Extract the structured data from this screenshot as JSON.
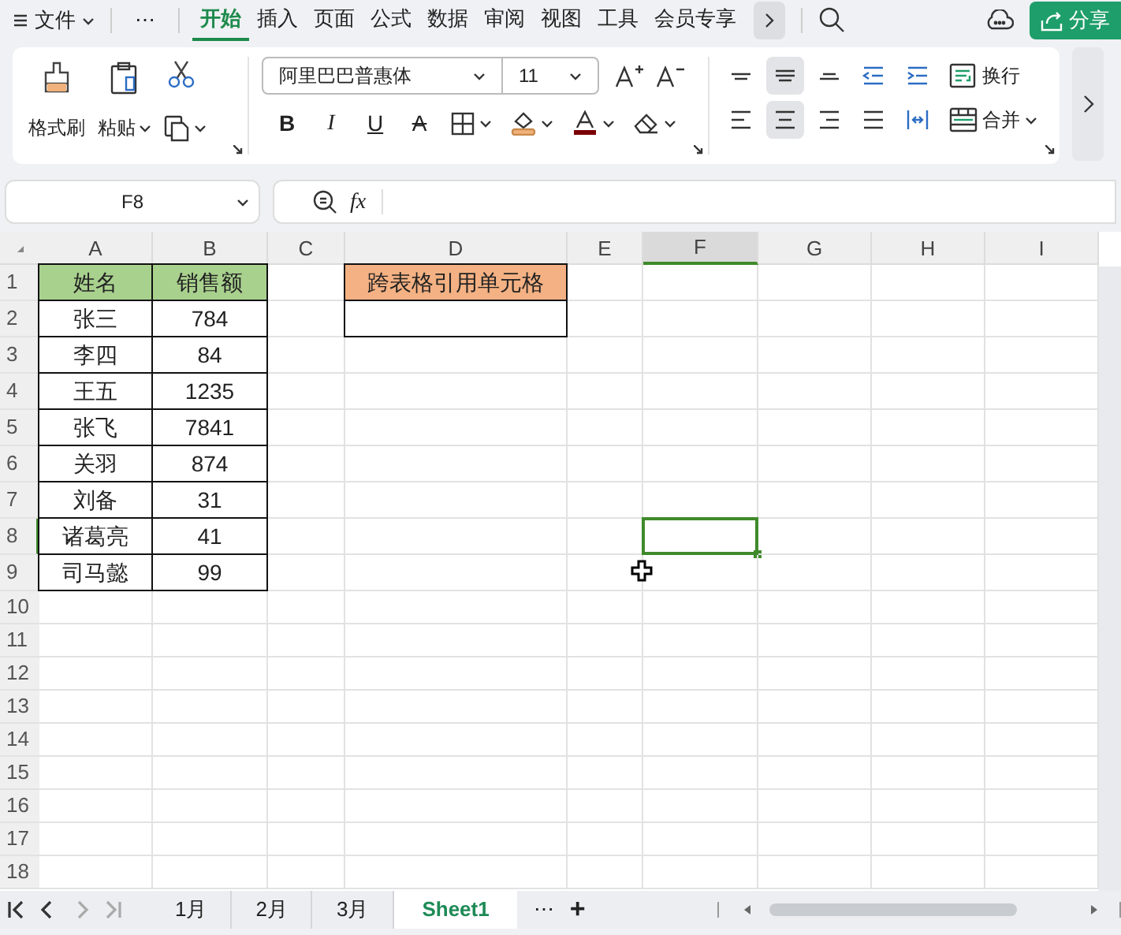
{
  "menu_bar": {
    "file_menu": "文件",
    "more": "⋯",
    "tabs": [
      {
        "label": "开始",
        "selected": true
      },
      {
        "label": "插入",
        "selected": false
      },
      {
        "label": "页面",
        "selected": false
      },
      {
        "label": "公式",
        "selected": false
      },
      {
        "label": "数据",
        "selected": false
      },
      {
        "label": "审阅",
        "selected": false
      },
      {
        "label": "视图",
        "selected": false
      },
      {
        "label": "工具",
        "selected": false
      },
      {
        "label": "会员专享",
        "selected": false
      }
    ],
    "share": "分享"
  },
  "ribbon": {
    "format_painter": "格式刷",
    "paste": "粘贴",
    "font_name": "阿里巴巴普惠体",
    "font_size": "11",
    "style_buttons": [
      {
        "kind": "bold",
        "label": "B"
      },
      {
        "kind": "italic",
        "label": "I"
      },
      {
        "kind": "underline",
        "label": "U"
      },
      {
        "kind": "strike",
        "label": "A"
      }
    ],
    "align_rows": [
      [
        {
          "kind": "top",
          "selected": false
        },
        {
          "kind": "middle",
          "selected": true
        },
        {
          "kind": "bottom",
          "selected": false
        },
        {
          "kind": "outdent",
          "selected": false
        },
        {
          "kind": "indent",
          "selected": false
        }
      ],
      [
        {
          "kind": "left",
          "selected": false
        },
        {
          "kind": "center",
          "selected": true
        },
        {
          "kind": "right",
          "selected": false
        },
        {
          "kind": "justify",
          "selected": false
        },
        {
          "kind": "distributed",
          "selected": false
        }
      ]
    ],
    "wrap": "换行",
    "merge": "合并"
  },
  "formula_bar": {
    "name_box": "F8",
    "fx": "fx"
  },
  "grid": {
    "columns": [
      {
        "label": "A",
        "selected": false
      },
      {
        "label": "B",
        "selected": false
      },
      {
        "label": "C",
        "selected": false
      },
      {
        "label": "D",
        "selected": false
      },
      {
        "label": "E",
        "selected": false
      },
      {
        "label": "F",
        "selected": true
      },
      {
        "label": "G",
        "selected": false
      },
      {
        "label": "H",
        "selected": false
      },
      {
        "label": "I",
        "selected": false
      }
    ],
    "rows": [
      {
        "label": "1",
        "selected": false,
        "cells": [
          {
            "text": "姓名",
            "color": "#a9d18e",
            "bordered": true,
            "selected": false
          },
          {
            "text": "销售额",
            "color": "#a9d18e",
            "bordered": true,
            "selected": false
          },
          {
            "text": "",
            "bordered": false,
            "selected": false
          },
          {
            "text": "跨表格引用单元格",
            "color": "#f4b183",
            "bordered": true,
            "selected": false
          }
        ]
      },
      {
        "label": "2",
        "selected": false,
        "cells": [
          {
            "text": "张三",
            "bordered": true,
            "selected": false
          },
          {
            "text": "784",
            "bordered": true,
            "selected": false
          },
          {
            "text": "",
            "bordered": false,
            "selected": false
          },
          {
            "text": "",
            "bordered": true,
            "selected": false
          }
        ]
      },
      {
        "label": "3",
        "selected": false,
        "cells": [
          {
            "text": "李四",
            "bordered": true,
            "selected": false
          },
          {
            "text": "84",
            "bordered": true,
            "selected": false
          }
        ]
      },
      {
        "label": "4",
        "selected": false,
        "cells": [
          {
            "text": "王五",
            "bordered": true,
            "selected": false
          },
          {
            "text": "1235",
            "bordered": true,
            "selected": false
          }
        ]
      },
      {
        "label": "5",
        "selected": false,
        "cells": [
          {
            "text": "张飞",
            "bordered": true,
            "selected": false
          },
          {
            "text": "7841",
            "bordered": true,
            "selected": false
          }
        ]
      },
      {
        "label": "6",
        "selected": false,
        "cells": [
          {
            "text": "关羽",
            "bordered": true,
            "selected": false
          },
          {
            "text": "874",
            "bordered": true,
            "selected": false
          }
        ]
      },
      {
        "label": "7",
        "selected": false,
        "cells": [
          {
            "text": "刘备",
            "bordered": true,
            "selected": false
          },
          {
            "text": "31",
            "bordered": true,
            "selected": false
          }
        ]
      },
      {
        "label": "8",
        "selected": true,
        "cells": [
          {
            "text": "诸葛亮",
            "bordered": true,
            "selected": false
          },
          {
            "text": "41",
            "bordered": true,
            "selected": false
          },
          {
            "text": "",
            "bordered": false,
            "selected": false
          },
          {
            "text": "",
            "bordered": false,
            "selected": false
          },
          {
            "text": "",
            "bordered": false,
            "selected": false
          },
          {
            "text": "",
            "bordered": false,
            "selected": true
          }
        ]
      },
      {
        "label": "9",
        "selected": false,
        "cells": [
          {
            "text": "司马懿",
            "bordered": true,
            "selected": false
          },
          {
            "text": "99",
            "bordered": true,
            "selected": false
          }
        ]
      },
      {
        "label": "10",
        "selected": false,
        "cells": []
      },
      {
        "label": "11",
        "selected": false,
        "cells": []
      },
      {
        "label": "12",
        "selected": false,
        "cells": []
      },
      {
        "label": "13",
        "selected": false,
        "cells": []
      },
      {
        "label": "14",
        "selected": false,
        "cells": []
      },
      {
        "label": "15",
        "selected": false,
        "cells": []
      },
      {
        "label": "16",
        "selected": false,
        "cells": []
      },
      {
        "label": "17",
        "selected": false,
        "cells": []
      },
      {
        "label": "18",
        "selected": false,
        "cells": []
      }
    ]
  },
  "sheet_bar": {
    "sheets": [
      {
        "label": "1月",
        "selected": false
      },
      {
        "label": "2月",
        "selected": false
      },
      {
        "label": "3月",
        "selected": false
      },
      {
        "label": "Sheet1",
        "selected": true
      }
    ],
    "more": "⋯",
    "add": "+"
  }
}
